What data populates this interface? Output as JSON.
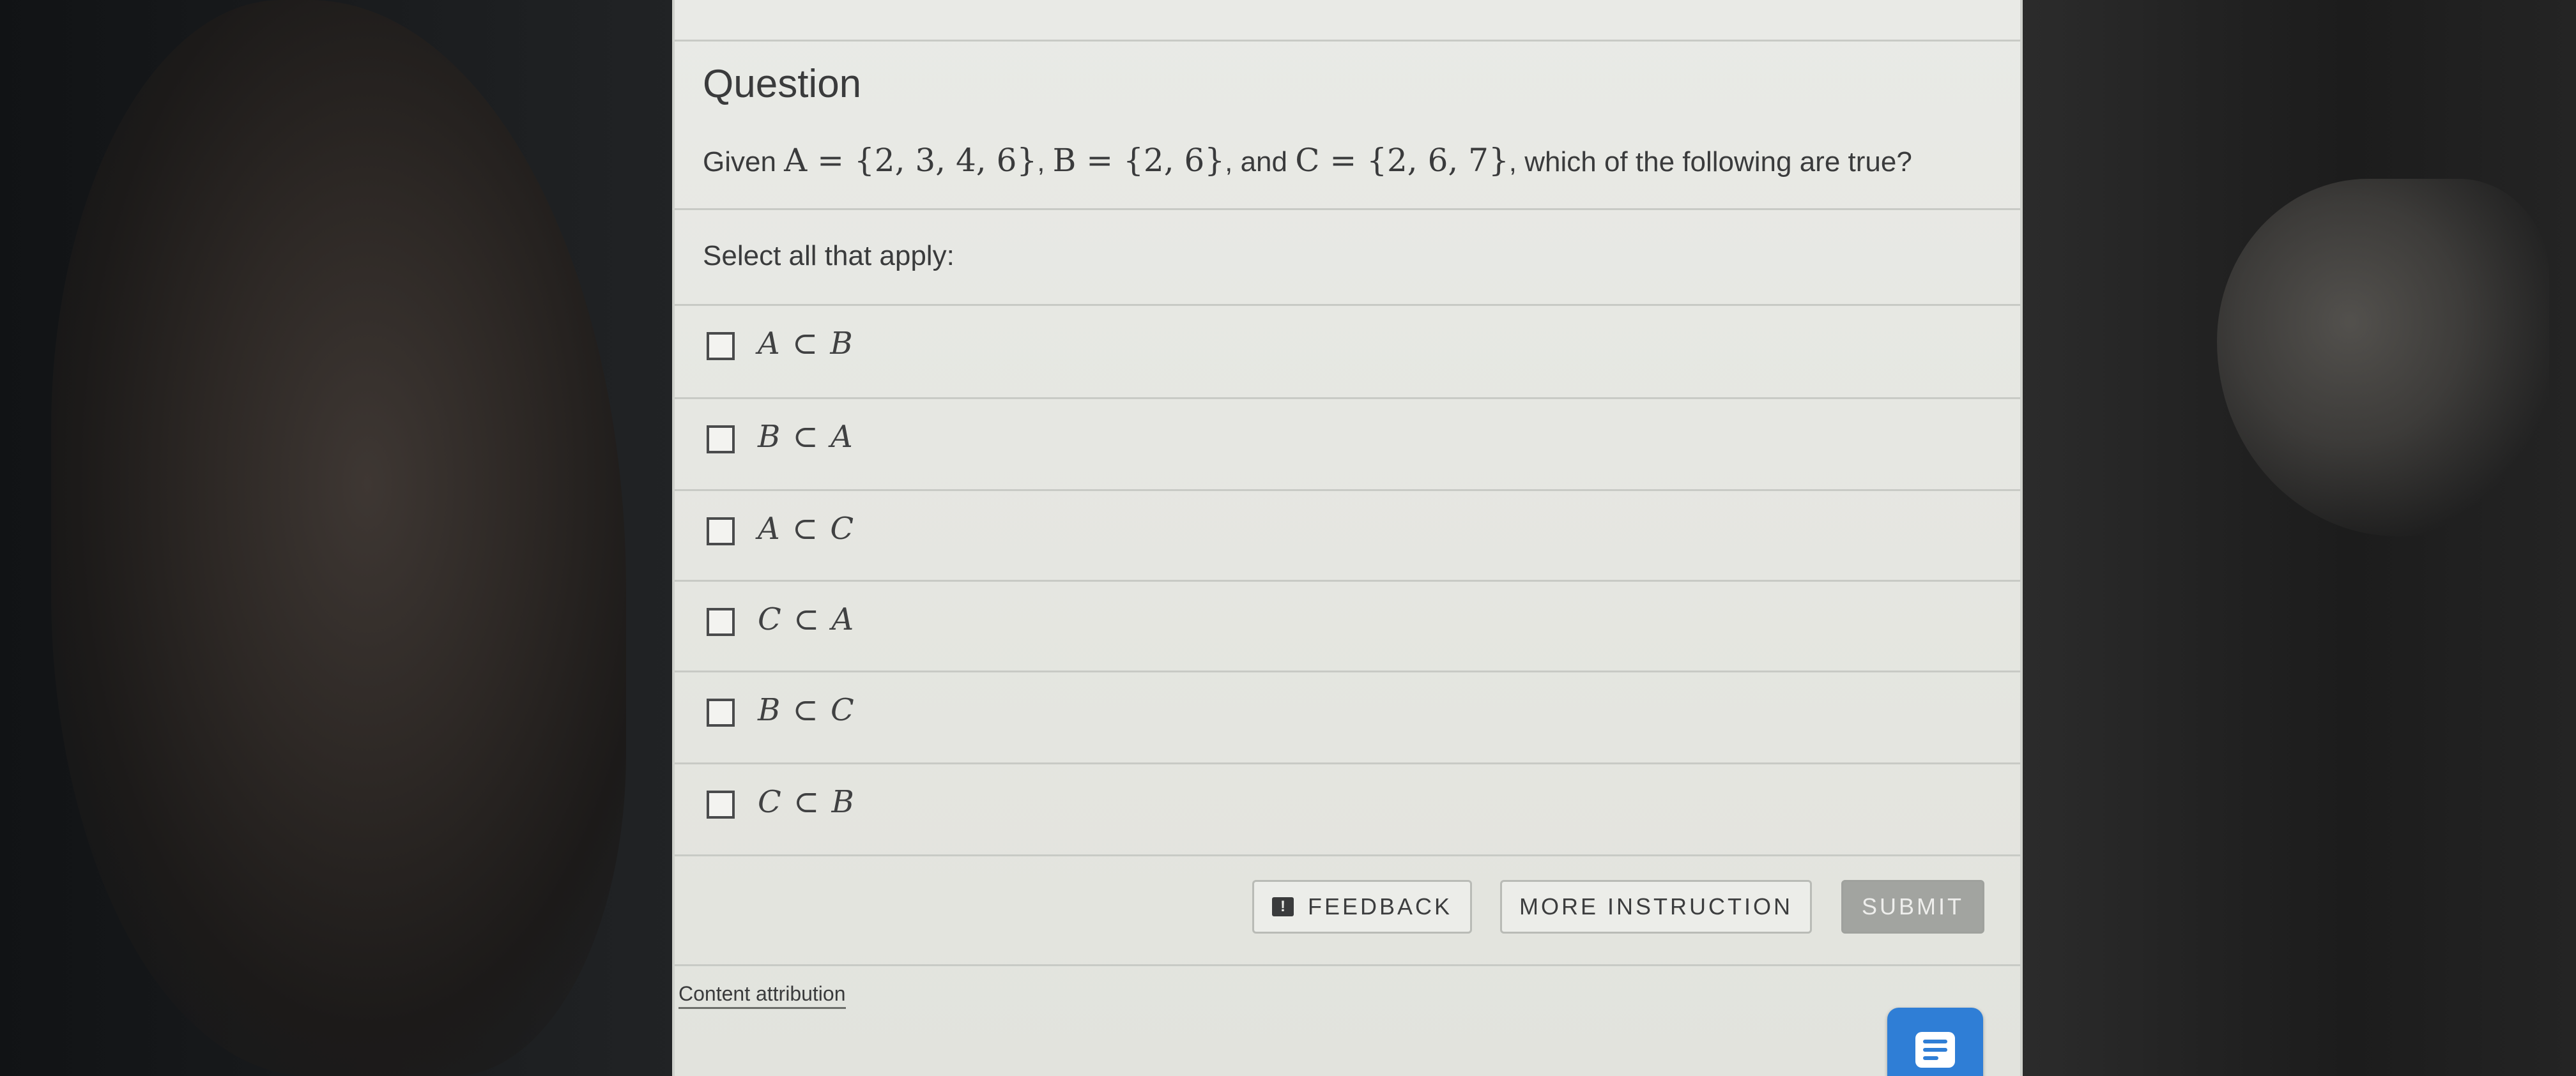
{
  "question": {
    "title": "Question",
    "prompt_prefix": "Given ",
    "set_a_expr": "A = {2, 3, 4, 6}",
    "sep1": ", ",
    "set_b_expr": "B = {2, 6}",
    "sep2": ", and ",
    "set_c_expr": "C = {2, 6, 7}",
    "prompt_suffix": ", which of the following are true?"
  },
  "instructions": "Select all that apply:",
  "options": [
    {
      "label": "A ⊂ B",
      "checked": false
    },
    {
      "label": "B ⊂ A",
      "checked": false
    },
    {
      "label": "A ⊂ C",
      "checked": false
    },
    {
      "label": "C ⊂ A",
      "checked": false
    },
    {
      "label": "B ⊂ C",
      "checked": false
    },
    {
      "label": "C ⊂ B",
      "checked": false
    }
  ],
  "buttons": {
    "feedback_icon": "!",
    "feedback": "FEEDBACK",
    "more_instruction": "MORE INSTRUCTION",
    "submit": "SUBMIT"
  },
  "footer": {
    "attribution": "Content attribution"
  },
  "icons": {
    "feedback": "exclamation-bubble-icon",
    "chat": "chat-message-icon"
  },
  "colors": {
    "chat_button": "#2f7ed6",
    "submit_disabled": "#a2a4a0"
  }
}
